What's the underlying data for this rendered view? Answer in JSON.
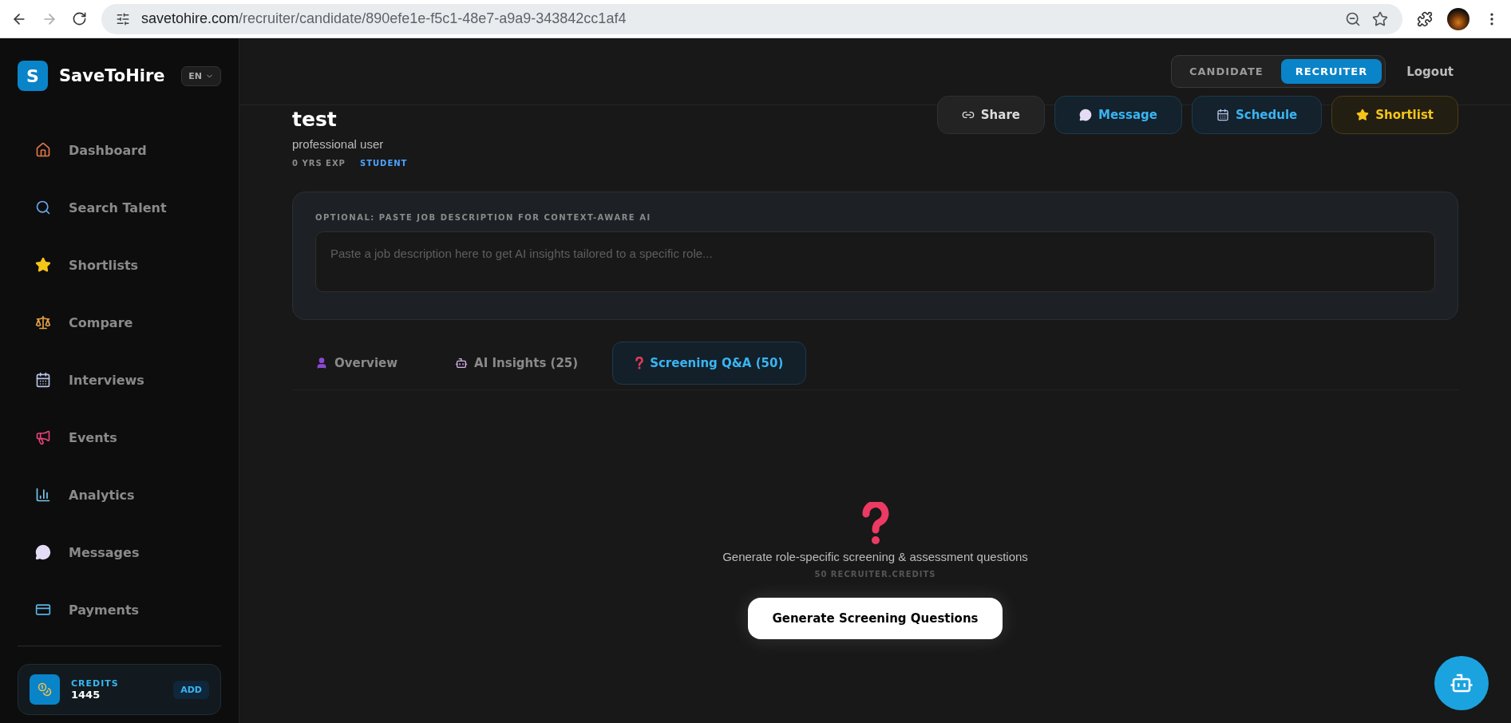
{
  "browser": {
    "url_host": "savetohire.com",
    "url_path": "/recruiter/candidate/890efe1e-f5c1-48e7-a9a9-343842cc1af4"
  },
  "sidebar": {
    "logo_letter": "S",
    "brand": "SaveToHire",
    "language": "EN",
    "items": [
      {
        "label": "Dashboard",
        "kind": "home"
      },
      {
        "label": "Search Talent",
        "kind": "search"
      },
      {
        "label": "Shortlists",
        "kind": "star"
      },
      {
        "label": "Compare",
        "kind": "scale"
      },
      {
        "label": "Interviews",
        "kind": "calendar"
      },
      {
        "label": "Events",
        "kind": "megaphone"
      },
      {
        "label": "Analytics",
        "kind": "chart"
      },
      {
        "label": "Messages",
        "kind": "chat"
      },
      {
        "label": "Payments",
        "kind": "card"
      }
    ],
    "credits": {
      "label": "CREDITS",
      "value": "1445",
      "button": "ADD"
    }
  },
  "header": {
    "modes": [
      {
        "label": "CANDIDATE",
        "selected": false
      },
      {
        "label": "RECRUITER",
        "selected": true
      }
    ],
    "logout": "Logout"
  },
  "profile": {
    "name": "test",
    "headline": "professional user",
    "tags": [
      {
        "label": "0 YRS EXP",
        "kind": "muted"
      },
      {
        "label": "STUDENT",
        "kind": "accent"
      }
    ]
  },
  "actions": [
    {
      "label": "Share",
      "kind": "share"
    },
    {
      "label": "Message",
      "kind": "message"
    },
    {
      "label": "Schedule",
      "kind": "schedule"
    },
    {
      "label": "Shortlist",
      "kind": "shortlist"
    }
  ],
  "job_description": {
    "label": "OPTIONAL: PASTE JOB DESCRIPTION FOR CONTEXT-AWARE AI",
    "placeholder": "Paste a job description here to get AI insights tailored to a specific role..."
  },
  "tabs": [
    {
      "label": "Overview",
      "kind": "user",
      "selected": false
    },
    {
      "label": "AI Insights (25)",
      "kind": "robot",
      "selected": false
    },
    {
      "label": "Screening Q&A (50)",
      "kind": "question",
      "selected": true
    }
  ],
  "empty_state": {
    "description": "Generate role-specific screening & assessment questions",
    "cost": "50 RECRUITER.CREDITS",
    "button": "Generate Screening Questions"
  }
}
